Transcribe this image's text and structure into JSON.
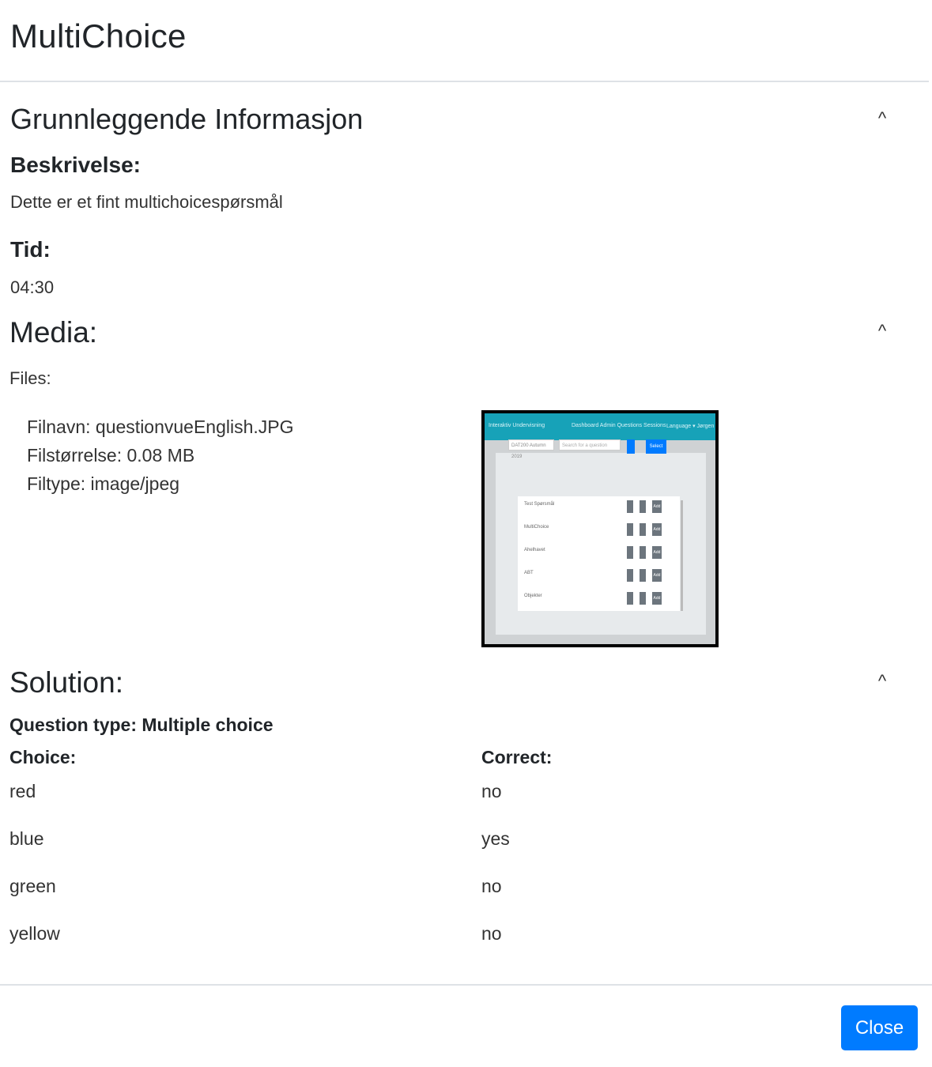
{
  "modal": {
    "title": "MultiChoice"
  },
  "basic_info": {
    "heading": "Grunnleggende Informasjon",
    "toggle": "^",
    "description_label": "Beskrivelse:",
    "description": "Dette er et fint multichoicespørsmål",
    "time_label": "Tid:",
    "time": "04:30"
  },
  "media": {
    "heading": "Media:",
    "toggle": "^",
    "files_label": "Files:",
    "file": {
      "name_line": "Filnavn: questionvueEnglish.JPG",
      "size_line": "Filstørrelse: 0.08 MB",
      "type_line": "Filtype: image/jpeg"
    },
    "thumbnail": {
      "nav_brand": "Interaktiv Undervisning",
      "nav_links": "Dashboard   Admin   Questions   Sessions",
      "nav_right": "Language ▾   Jørgen Waldmann ▾",
      "select_text": "DAT200 Autumn 2019",
      "search_placeholder": "Search for a question",
      "select_button": "Select",
      "rows": [
        "Test Spørsmål",
        "MultiChoice",
        "Ahelhavet",
        "ABT",
        "Objekter"
      ],
      "add_label": "Add"
    }
  },
  "solution": {
    "heading": "Solution:",
    "toggle": "^",
    "question_type": "Question type: Multiple choice",
    "choice_header": "Choice:",
    "correct_header": "Correct:",
    "rows": [
      {
        "choice": "red",
        "correct": "no"
      },
      {
        "choice": "blue",
        "correct": "yes"
      },
      {
        "choice": "green",
        "correct": "no"
      },
      {
        "choice": "yellow",
        "correct": "no"
      }
    ]
  },
  "footer": {
    "close_label": "Close"
  },
  "colors": {
    "primary": "#007bff",
    "navbar": "#17a2b8",
    "divider": "#dee2e6"
  }
}
